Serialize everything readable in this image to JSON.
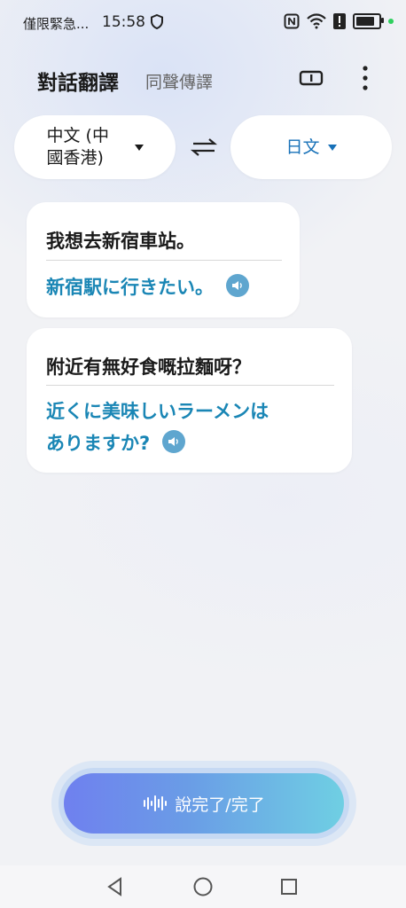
{
  "status_bar": {
    "carrier": "僅限緊急...",
    "time": "15:58",
    "icons": [
      "shield-icon",
      "nfc-icon",
      "wifi-icon",
      "alert-icon",
      "battery-icon",
      "notification-dot-icon"
    ]
  },
  "header": {
    "title": "對話翻譯",
    "subtitle": "同聲傳譯",
    "icons": [
      "split-screen-icon",
      "more-vert-icon"
    ]
  },
  "languages": {
    "source": "中文 (中國香港)",
    "target": "日文",
    "swap_icon": "swap-icon"
  },
  "conversation": [
    {
      "source": "我想去新宿車站。",
      "translation": "新宿駅に行きたい。"
    },
    {
      "source": "附近有無好食嘅拉麵呀？",
      "translation_line1": "近くに美味しいラーメンは",
      "translation_line2": "ありますか?"
    }
  ],
  "mic_button": {
    "label": "說完了/完了",
    "icon": "voice-wave-icon"
  },
  "nav": {
    "icons": [
      "back-icon",
      "home-icon",
      "recents-icon"
    ]
  },
  "colors": {
    "accent": "#1a86b5",
    "target_lang": "#1771b8",
    "speaker": "#5fa6cf",
    "mic_gradient_start": "#6f80ef",
    "mic_gradient_end": "#6fcfe3"
  }
}
